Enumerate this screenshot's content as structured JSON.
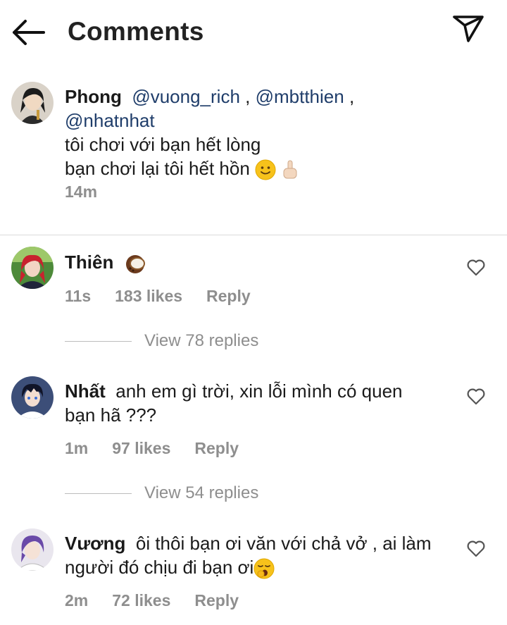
{
  "header": {
    "title": "Comments",
    "back_icon": "arrow-left-icon",
    "send_icon": "paper-plane-icon"
  },
  "caption": {
    "author": "Phong",
    "mentions": [
      "@vuong_rich",
      "@mbtthien",
      "@nhatnhat"
    ],
    "separator": " , ",
    "line1": "tôi chơi với bạn hết lòng",
    "line2": "bạn chơi lại tôi hết hồn",
    "time": "14m"
  },
  "comments": [
    {
      "author": "Thiên",
      "text": "",
      "emoji": "coconut",
      "time": "11s",
      "likes": "183 likes",
      "reply": "Reply",
      "view_replies": "View 78 replies"
    },
    {
      "author": "Nhất",
      "text_line1": "anh em gì trời, xin lỗi mình có quen",
      "text_line2": "bạn hã ???",
      "time": "1m",
      "likes": "97 likes",
      "reply": "Reply",
      "view_replies": "View 54 replies"
    },
    {
      "author": "Vương",
      "text_line1": "ôi thôi bạn ơi văn với chả vở , ai làm",
      "text_line2": "người đó chịu đi bạn ơi",
      "time": "2m",
      "likes": "72 likes",
      "reply": "Reply"
    }
  ],
  "colors": {
    "mention": "#1f3d6a",
    "meta": "#8e8e8e",
    "divider": "#dbdbdb"
  }
}
